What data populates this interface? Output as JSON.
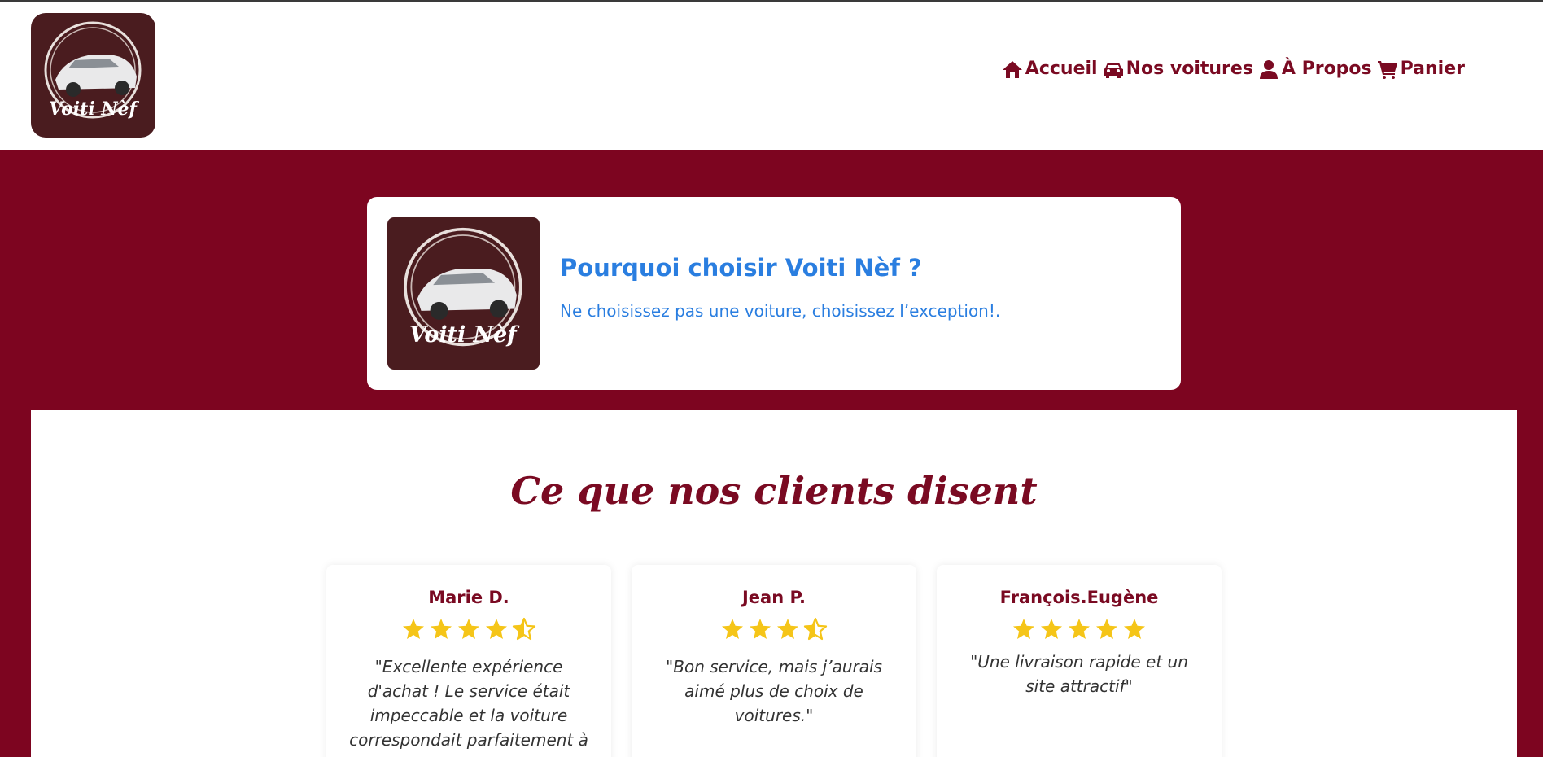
{
  "header": {
    "logo_text": "Voiti Nèf",
    "nav": [
      {
        "label": "Accueil",
        "icon": "home-icon"
      },
      {
        "label": "Nos voitures",
        "icon": "car-icon"
      },
      {
        "label": "À Propos",
        "icon": "user-icon"
      },
      {
        "label": "Panier",
        "icon": "cart-icon"
      }
    ]
  },
  "hero": {
    "logo_text": "Voiti Nèf",
    "title": "Pourquoi choisir Voiti Nèf ?",
    "subtitle": "Ne choisissez pas une voiture, choisissez l’exception!."
  },
  "testimonials": {
    "title": "Ce que nos clients disent",
    "reviews": [
      {
        "name": "Marie D.",
        "rating": 4.5,
        "text": "\"Excellente expérience d'achat ! Le service était impeccable et la voiture correspondait parfaitement à"
      },
      {
        "name": "Jean P.",
        "rating": 3.5,
        "text": "\"Bon service, mais j’aurais aimé plus de choix de voitures.\""
      },
      {
        "name": "François.Eugène",
        "rating": 5,
        "text": "\"Une livraison rapide et un site attractif\""
      }
    ]
  },
  "colors": {
    "brand": "#7d0520",
    "hero_text": "#2a7ee0",
    "star": "#f5c518",
    "logo_bg": "#4a1c1f"
  }
}
